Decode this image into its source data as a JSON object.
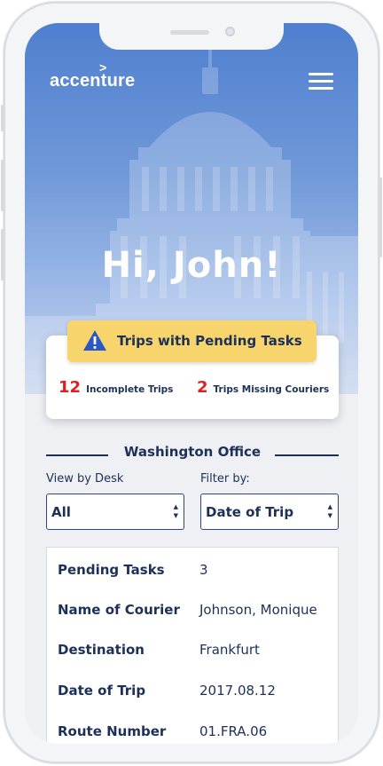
{
  "header": {
    "brand": "accenture",
    "brand_mark": ">",
    "menu_icon": "hamburger-menu-icon"
  },
  "greeting": "Hi, John!",
  "pending": {
    "button_label": "Trips with Pending Tasks",
    "icon": "warning-icon",
    "incomplete_count": "12",
    "incomplete_label": "Incomplete Trips",
    "missing_count": "2",
    "missing_label": "Trips Missing Couriers"
  },
  "office": {
    "title": "Washington Office"
  },
  "filters": {
    "view_label": "View by Desk",
    "view_value": "All",
    "filter_label": "Filter by:",
    "filter_value": "Date of Trip"
  },
  "trip": {
    "rows": [
      {
        "key": "Pending Tasks",
        "value": "3"
      },
      {
        "key": "Name of Courier",
        "value": "Johnson, Monique"
      },
      {
        "key": "Destination",
        "value": "Frankfurt"
      },
      {
        "key": "Date of Trip",
        "value": "2017.08.12"
      },
      {
        "key": "Route Number",
        "value": "01.FRA.06"
      }
    ]
  },
  "colors": {
    "navy": "#1d3058",
    "accent_yellow": "#f7d56c",
    "alert_red": "#e02020",
    "hero_blue": "#4f7fcf"
  }
}
